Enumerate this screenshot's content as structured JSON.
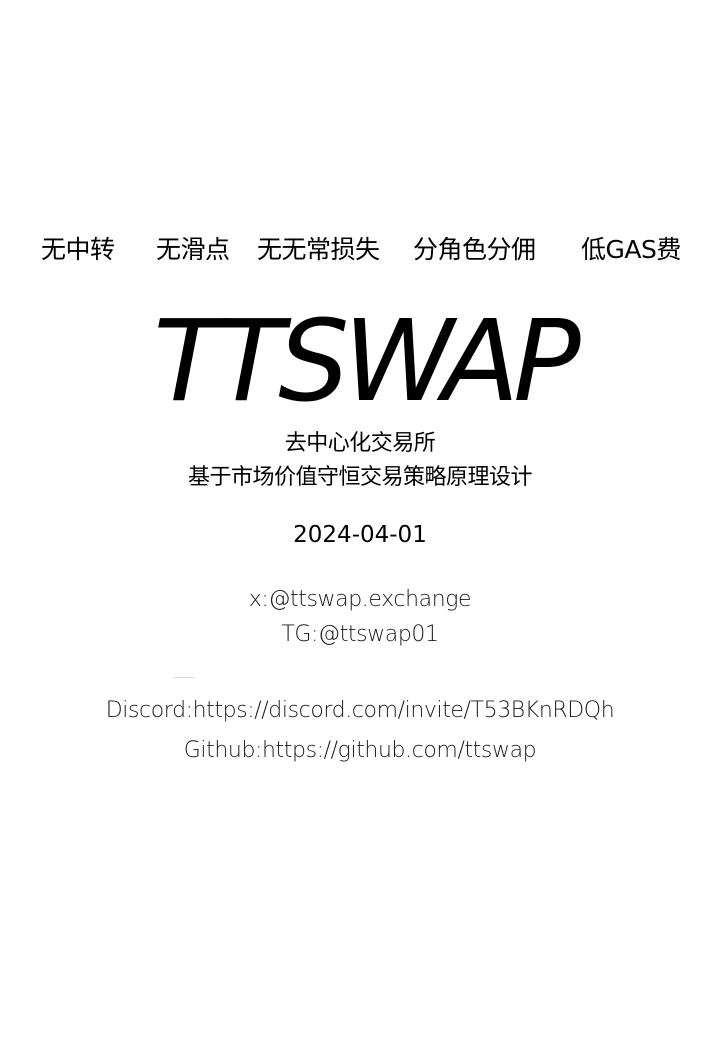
{
  "features": [
    "无中转",
    "无滑点",
    "无无常损失",
    "分角色分佣",
    "低GAS费"
  ],
  "logo": "TTSWAP",
  "subtitle_1": "去中心化交易所",
  "subtitle_2": "基于市场价值守恒交易策略原理设计",
  "date": "2024-04-01",
  "contacts": {
    "x": "x:@ttswap.exchange",
    "tg": "TG:@ttswap01",
    "discord": "Discord:https://discord.com/invite/T53BKnRDQh",
    "github": "Github:https://github.com/ttswap"
  }
}
